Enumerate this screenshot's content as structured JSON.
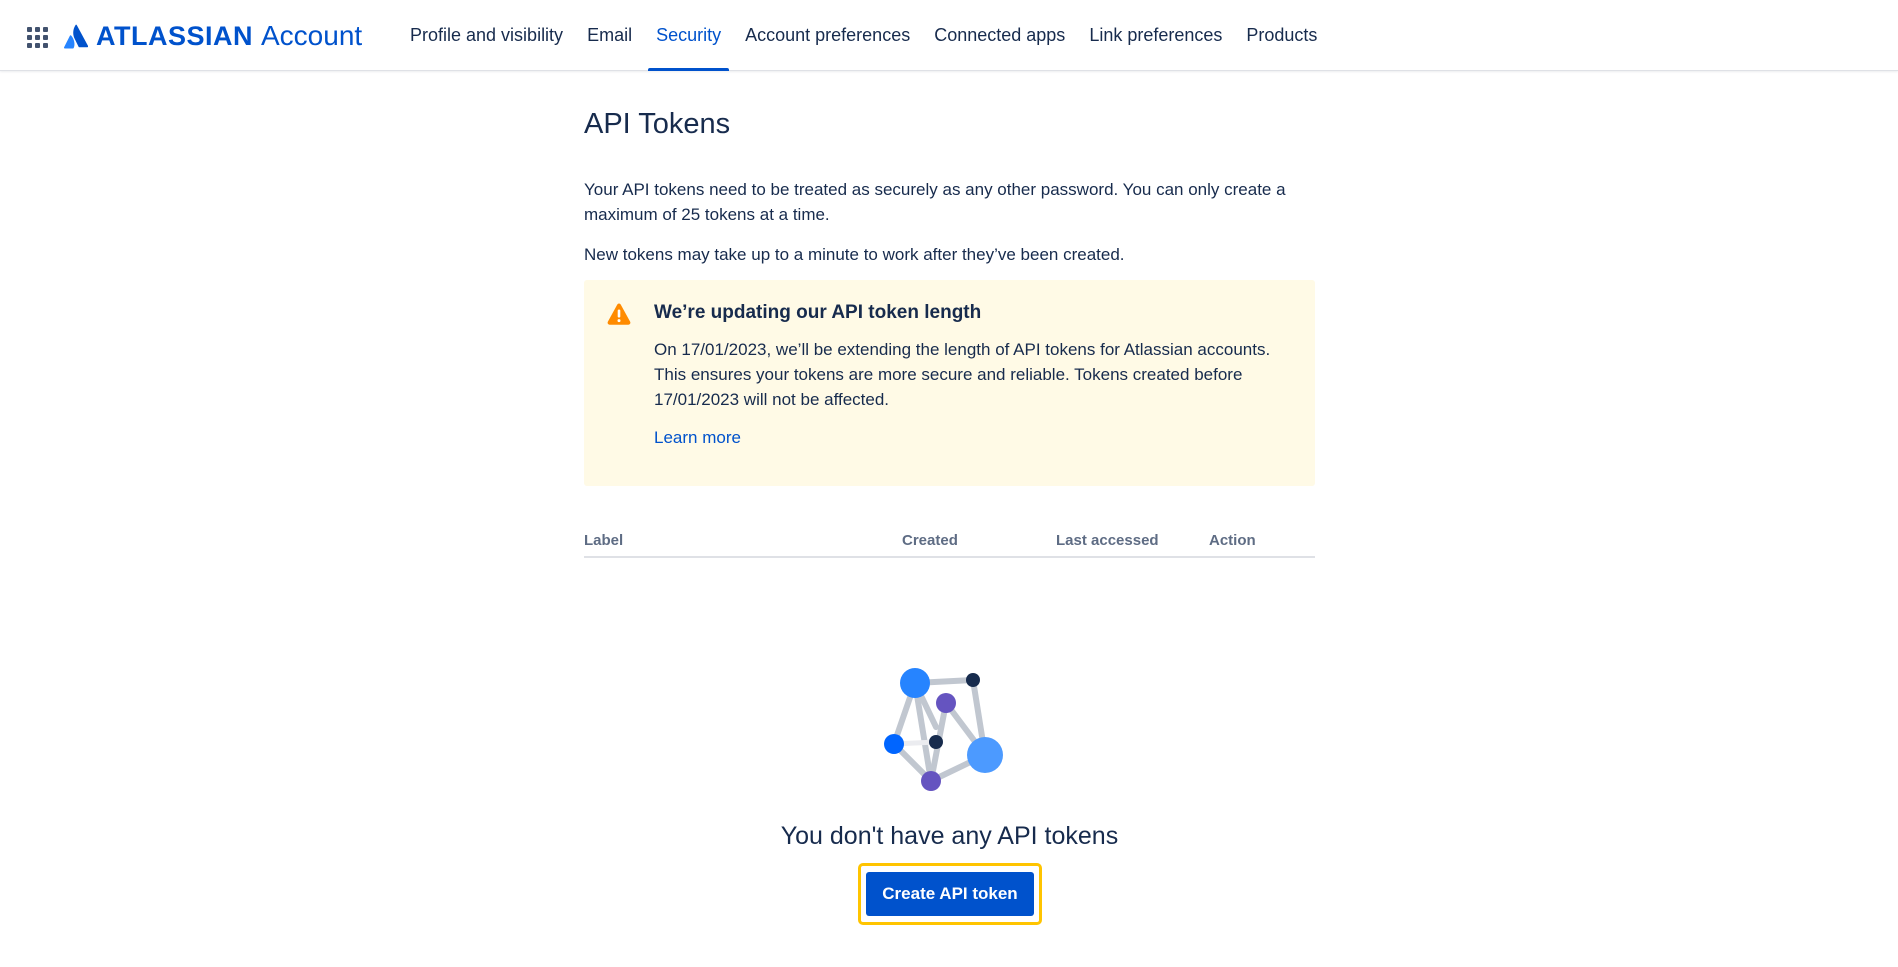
{
  "header": {
    "brand": "ATLASSIAN",
    "product": "Account",
    "app_switcher_icon": "grid-icon",
    "nav": [
      {
        "label": "Profile and visibility",
        "active": false
      },
      {
        "label": "Email",
        "active": false
      },
      {
        "label": "Security",
        "active": true
      },
      {
        "label": "Account preferences",
        "active": false
      },
      {
        "label": "Connected apps",
        "active": false
      },
      {
        "label": "Link preferences",
        "active": false
      },
      {
        "label": "Products",
        "active": false
      }
    ]
  },
  "main": {
    "title": "API Tokens",
    "intro": "Your API tokens need to be treated as securely as any other password. You can only create a maximum of 25 tokens at a time.",
    "note": "New tokens may take up to a minute to work after they’ve been created.",
    "warning": {
      "icon": "warning-icon",
      "title": "We’re updating our API token length",
      "body": "On 17/01/2023, we’ll be extending the length of API tokens for Atlassian accounts. This ensures your tokens are more secure and reliable. Tokens created before 17/01/2023 will not be affected.",
      "link": "Learn more"
    },
    "table": {
      "columns": [
        "Label",
        "Created",
        "Last accessed",
        "Action"
      ]
    },
    "empty": {
      "illustration": "network-nodes-illustration",
      "title": "You don't have any API tokens",
      "button": "Create API token"
    }
  },
  "colors": {
    "brand": "#0052CC",
    "text": "#172B4D",
    "warning_bg": "#FFFAE6",
    "warning_icon": "#FF8B00",
    "focus_ring": "#FFC400"
  }
}
